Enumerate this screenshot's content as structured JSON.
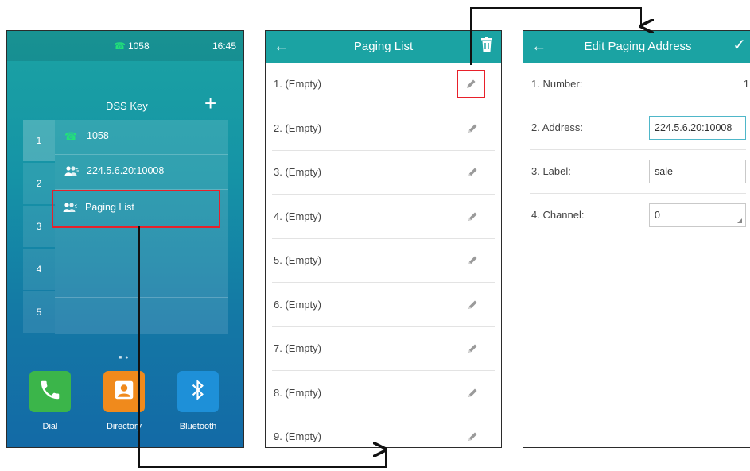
{
  "phone": {
    "status_ext": "1058",
    "status_time": "16:45",
    "dss_title": "DSS Key",
    "add_symbol": "+",
    "tabs": [
      "1",
      "2",
      "3",
      "4",
      "5"
    ],
    "keys": [
      {
        "icon": "phone-icon",
        "label": "1058"
      },
      {
        "icon": "paging-icon",
        "label": "224.5.6.20:10008"
      },
      {
        "icon": "paging-icon",
        "label": "Paging List"
      }
    ],
    "dock": [
      {
        "icon": "phone-handset-icon",
        "label": "Dial",
        "color": "#3bb54a"
      },
      {
        "icon": "contact-card-icon",
        "label": "Directory",
        "color": "#f08a1c"
      },
      {
        "icon": "bluetooth-icon",
        "label": "Bluetooth",
        "color": "#1e90d8"
      }
    ]
  },
  "paging_list": {
    "title": "Paging List",
    "items": [
      "1. (Empty)",
      "2. (Empty)",
      "3. (Empty)",
      "4. (Empty)",
      "5. (Empty)",
      "6. (Empty)",
      "7. (Empty)",
      "8. (Empty)",
      "9. (Empty)"
    ]
  },
  "edit_paging": {
    "title": "Edit Paging Address",
    "number_label": "1. Number:",
    "number_value": "1",
    "address_label": "2. Address:",
    "address_value": "224.5.6.20:10008",
    "label_label": "3. Label:",
    "label_value": "sale",
    "channel_label": "4. Channel:",
    "channel_value": "0"
  },
  "colors": {
    "accent": "#1ba3a3",
    "highlight": "#e8202a"
  }
}
